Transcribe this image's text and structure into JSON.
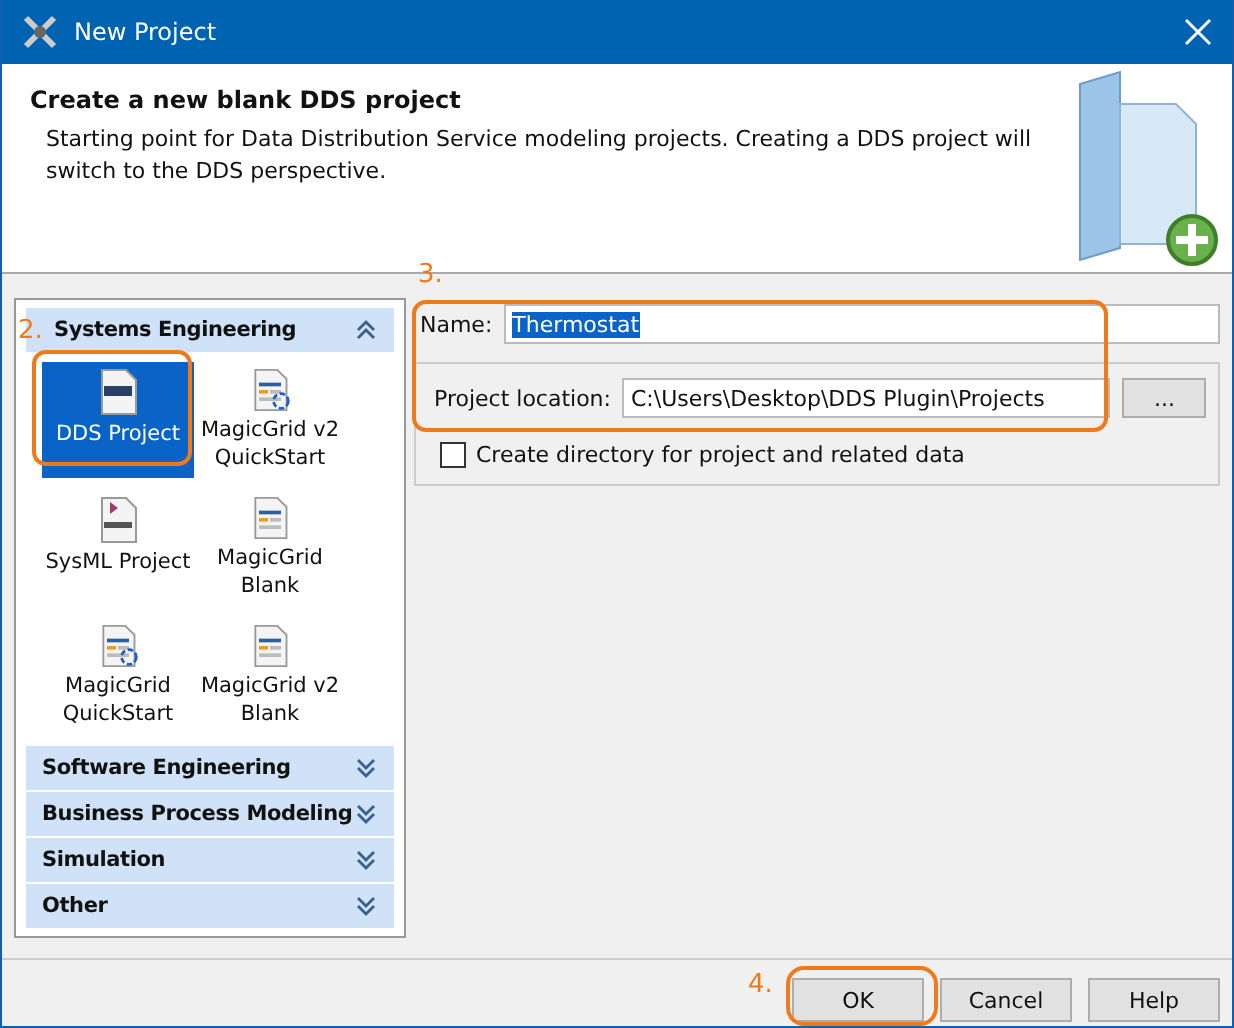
{
  "window": {
    "title": "New Project"
  },
  "header": {
    "title": "Create a new blank DDS project",
    "description": "Starting point for Data Distribution Service modeling projects. Creating a DDS project will switch to the DDS perspective."
  },
  "categories": [
    {
      "label": "Systems Engineering",
      "expanded": true,
      "items": [
        {
          "label": "DDS Project",
          "kind": "dds",
          "selected": true
        },
        {
          "label": "MagicGrid v2 QuickStart",
          "kind": "grid-quick",
          "selected": false
        },
        {
          "label": "SysML Project",
          "kind": "sysml",
          "selected": false
        },
        {
          "label": "MagicGrid Blank",
          "kind": "grid",
          "selected": false
        },
        {
          "label": "MagicGrid QuickStart",
          "kind": "grid-quick",
          "selected": false
        },
        {
          "label": "MagicGrid v2 Blank",
          "kind": "grid",
          "selected": false
        }
      ]
    },
    {
      "label": "Software Engineering",
      "expanded": false
    },
    {
      "label": "Business Process Modeling",
      "expanded": false
    },
    {
      "label": "Simulation",
      "expanded": false
    },
    {
      "label": "Other",
      "expanded": false
    }
  ],
  "form": {
    "name_label": "Name:",
    "name_value": "Thermostat",
    "location_label": "Project location:",
    "location_value": "C:\\Users\\Desktop\\DDS Plugin\\Projects",
    "browse_button": "...",
    "create_directory": {
      "label": "Create directory for project and related data",
      "checked": false
    }
  },
  "buttons": [
    {
      "label": "OK"
    },
    {
      "label": "Cancel"
    },
    {
      "label": "Help"
    }
  ],
  "annotations": [
    {
      "label": "2."
    },
    {
      "label": "3."
    },
    {
      "label": "4."
    }
  ]
}
